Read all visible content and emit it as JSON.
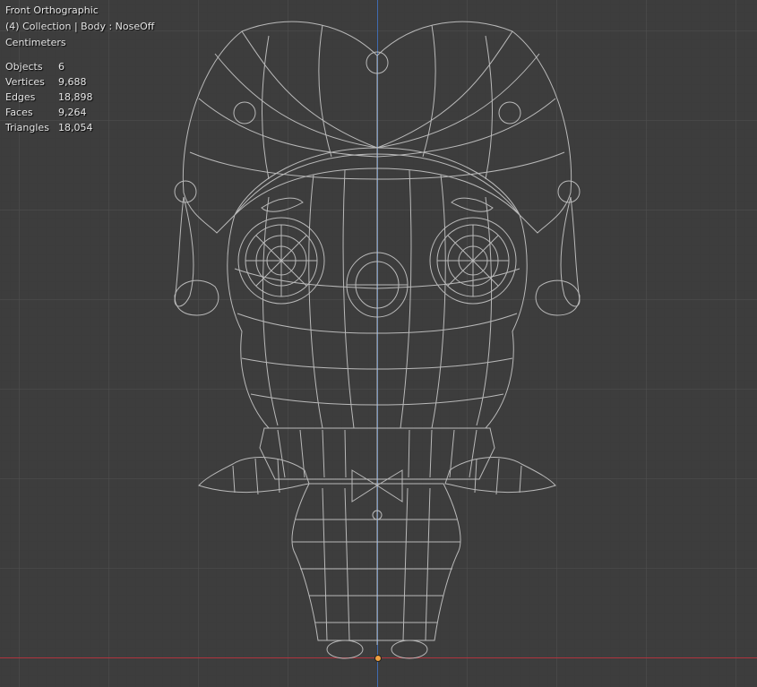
{
  "overlay": {
    "view_name": "Front Orthographic",
    "collection": "(4) Collection | Body : NoseOff",
    "units": "Centimeters"
  },
  "stats": [
    {
      "label": "Objects",
      "value": "6"
    },
    {
      "label": "Vertices",
      "value": "9,688"
    },
    {
      "label": "Edges",
      "value": "18,898"
    },
    {
      "label": "Faces",
      "value": "9,264"
    },
    {
      "label": "Triangles",
      "value": "18,054"
    }
  ],
  "colors": {
    "background": "#3d3d3d",
    "wire": "#cfcfcf",
    "axis_x": "#b0343e",
    "axis_z": "#3f6bb0",
    "origin": "#f0a040"
  }
}
